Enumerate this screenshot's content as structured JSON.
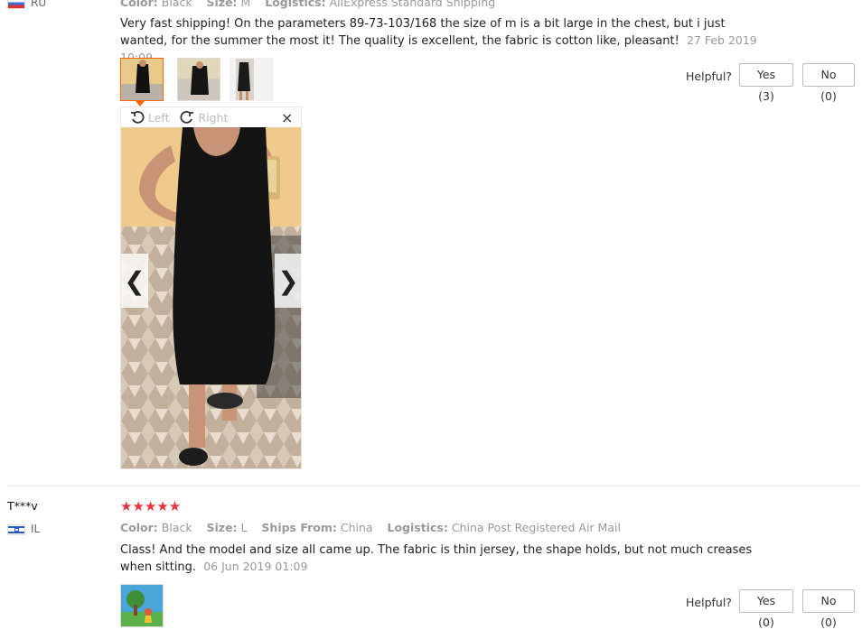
{
  "review1": {
    "country": "RU",
    "attributes": {
      "color_label": "Color:",
      "color_value": "Black",
      "size_label": "Size:",
      "size_value": "M",
      "logistics_label": "Logistics:",
      "logistics_value": "AliExpress Standard Shipping"
    },
    "text": "Very fast shipping! On the parameters 89-73-103/168 the size of m is a bit large in the chest, but i just wanted, for the summer the most it! The quality is excellent, the fabric is cotton like, pleasant!",
    "date": "27 Feb 2019 10:09",
    "helpful_label": "Helpful?",
    "yes_label": "Yes (3)",
    "no_label": "No (0)",
    "viewer": {
      "rotate_left": "Left",
      "rotate_right": "Right",
      "close": "×",
      "prev": "❮",
      "next": "❯"
    }
  },
  "review2": {
    "reviewer": "T***v",
    "country": "IL",
    "rating": "★★★★★",
    "attributes": {
      "color_label": "Color:",
      "color_value": "Black",
      "size_label": "Size:",
      "size_value": "L",
      "ships_label": "Ships From:",
      "ships_value": "China",
      "logistics_label": "Logistics:",
      "logistics_value": "China Post Registered Air Mail"
    },
    "text": "Class! And the model and size all came up. The fabric is thin jersey, the shape holds, but not much creases when sitting.",
    "date": "06 Jun 2019 01:09",
    "helpful_label": "Helpful?",
    "yes_label": "Yes (0)",
    "no_label": "No (0)"
  },
  "colors": {
    "accent": "#ff6600",
    "star": "#e5323e"
  }
}
